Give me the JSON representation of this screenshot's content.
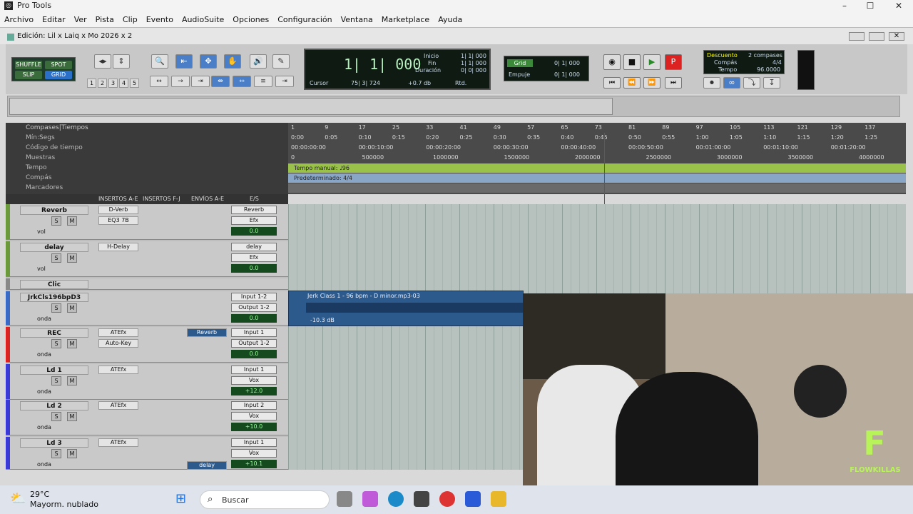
{
  "window": {
    "title": "Pro Tools",
    "edit_title": "Edición: Lil x Laiq x Mo 2026 x 2"
  },
  "menu": [
    "Archivo",
    "Editar",
    "Ver",
    "Pista",
    "Clip",
    "Evento",
    "AudioSuite",
    "Opciones",
    "Configuración",
    "Ventana",
    "Marketplace",
    "Ayuda"
  ],
  "modes": {
    "shuffle": "SHUFFLE",
    "spot": "SPOT",
    "slip": "SLIP",
    "grid": "GRID"
  },
  "zoom_presets": [
    "1",
    "2",
    "3",
    "4",
    "5"
  ],
  "counter": {
    "main": "1| 1| 000",
    "inicio_label": "Inicio",
    "fin_label": "Fin",
    "duracion_label": "Duración",
    "inicio": "1| 1| 000",
    "fin": "1| 1| 000",
    "duracion": "0| 0| 000",
    "cursor_label": "Cursor",
    "cursor": "75| 3| 724",
    "db": "+0.7 db",
    "rtd": "Rtd."
  },
  "grid": {
    "grid_label": "Grid",
    "grid_value": "0| 1| 000",
    "empuje_label": "Empuje",
    "empuje_value": "0| 1| 000"
  },
  "meter": {
    "descuento": "Descuento",
    "compases": "2 compases",
    "compas_label": "Compás",
    "compas_value": "4/4",
    "tempo_label": "Tempo",
    "tempo_value": "96.0000"
  },
  "ruler": {
    "compases_label": "Compases|Tiempos",
    "minsegs_label": "Mín:Segs",
    "codigo_label": "Código de tiempo",
    "muestras_label": "Muestras",
    "tempo_label": "Tempo",
    "compas_label": "Compás",
    "marcadores_label": "Marcadores",
    "bars": [
      "1",
      "9",
      "17",
      "25",
      "33",
      "41",
      "49",
      "57",
      "65",
      "73",
      "81",
      "89",
      "97",
      "105",
      "113",
      "121",
      "129",
      "137"
    ],
    "minsegs": [
      "0:00",
      "0:05",
      "0:10",
      "0:15",
      "0:20",
      "0:25",
      "0:30",
      "0:35",
      "0:40",
      "0:45",
      "0:50",
      "0:55",
      "1:00",
      "1:05",
      "1:10",
      "1:15",
      "1:20",
      "1:25"
    ],
    "timecode": [
      "00:00:00:00",
      "00:00:10:00",
      "00:00:20:00",
      "00:00:30:00",
      "00:00:40:00",
      "00:00:50:00",
      "00:01:00:00",
      "00:01:10:00",
      "00:01:20:00"
    ],
    "samples": [
      "0",
      "500000",
      "1000000",
      "1500000",
      "2000000",
      "2500000",
      "3000000",
      "3500000",
      "4000000"
    ],
    "tempo_text": "Tempo manual: ♩96",
    "compas_text": "Predeterminado: 4/4"
  },
  "columns": {
    "insertos_ae": "INSERTOS A-E",
    "insertos_fj": "INSERTOS F-J",
    "envios_ae": "ENVÍOS A-E",
    "es": "E/S"
  },
  "tracks": [
    {
      "name": "Reverb",
      "inserts": [
        "D-Verb",
        "EQ3 7B"
      ],
      "input": "Reverb",
      "output": "Efx",
      "vol": "0.0",
      "mode": "vol"
    },
    {
      "name": "delay",
      "inserts": [
        "H-Delay"
      ],
      "input": "delay",
      "output": "Efx",
      "vol": "0.0",
      "mode": "vol"
    },
    {
      "name": "Clic",
      "inserts": [],
      "input": "",
      "output": "",
      "vol": "",
      "mode": ""
    },
    {
      "name": "JrkCls196bpD3",
      "inserts": [],
      "input": "Input 1-2",
      "output": "Output 1-2",
      "vol": "0.0",
      "mode": "onda"
    },
    {
      "name": "REC",
      "inserts": [
        "ATEfx",
        "Auto-Key"
      ],
      "send": "Reverb",
      "input": "Input 1",
      "output": "Output 1-2",
      "vol": "0.0",
      "mode": "onda"
    },
    {
      "name": "Ld 1",
      "inserts": [
        "ATEfx"
      ],
      "input": "Input 1",
      "output": "Vox",
      "vol": "+12.0",
      "mode": "onda"
    },
    {
      "name": "Ld 2",
      "inserts": [
        "ATEfx"
      ],
      "input": "Input 2",
      "output": "Vox",
      "vol": "+10.0",
      "mode": "onda"
    },
    {
      "name": "Ld 3",
      "inserts": [
        "ATEfx"
      ],
      "send": "delay",
      "input": "Input 1",
      "output": "Vox",
      "vol": "+10.1",
      "mode": "onda"
    }
  ],
  "clip": {
    "name": "Jerk Class 1 - 96 bpm - D minor.mp3-03",
    "gain": "-10.3 dB"
  },
  "overlay": {
    "brand": "FLOWKILLAS"
  },
  "taskbar": {
    "temp": "29°C",
    "weather": "Mayorm. nublado",
    "search_placeholder": "Buscar"
  },
  "colors": {
    "tempo_ruler": "#9ac24a",
    "clip": "#2d5a8c",
    "rec_red": "#d22"
  }
}
